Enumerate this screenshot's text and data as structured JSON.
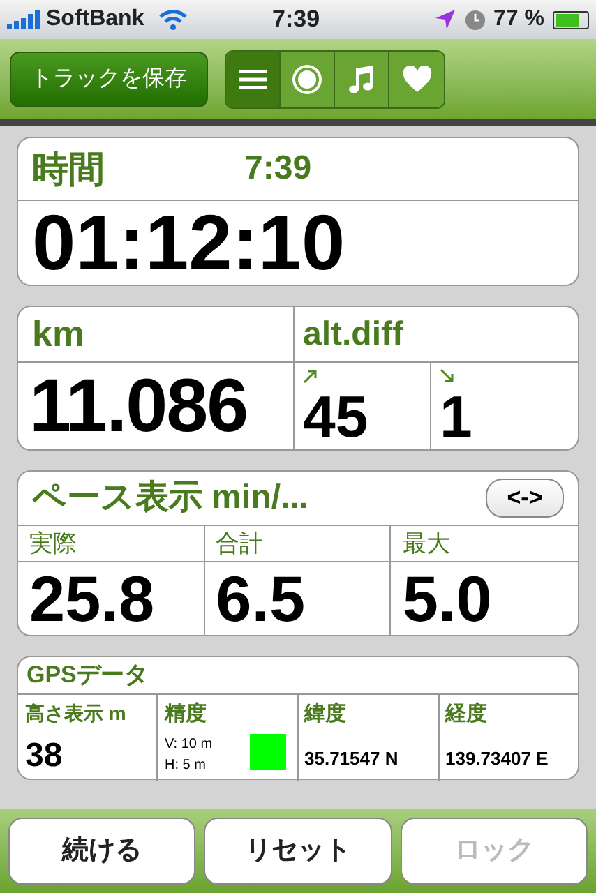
{
  "status_bar": {
    "carrier": "SoftBank",
    "time": "7:39",
    "battery": "77 %"
  },
  "toolbar": {
    "save_button": "トラックを保存",
    "segments": [
      {
        "kind": "list",
        "selected": true
      },
      {
        "kind": "record",
        "selected": false
      },
      {
        "kind": "music",
        "selected": false
      },
      {
        "kind": "heart",
        "selected": false
      }
    ]
  },
  "time_card": {
    "label": "時間",
    "clock": "7:39",
    "value": "01:12:10"
  },
  "distance_card": {
    "label": "km",
    "value": "11.086",
    "alt_label": "alt.diff",
    "ascent": "45",
    "descent": "1"
  },
  "pace_card": {
    "title": "ペース表示 min/...",
    "toggle": "<->",
    "columns": [
      {
        "label": "実際",
        "value": "25.8"
      },
      {
        "label": "合計",
        "value": "6.5"
      },
      {
        "label": "最大",
        "value": "5.0"
      }
    ]
  },
  "gps_card": {
    "title": "GPSデータ",
    "altitude_label": "高さ表示 m",
    "altitude": "38",
    "accuracy_label": "精度",
    "vertical": "V: 10 m",
    "horizontal": "H: 5 m",
    "accuracy_good": true,
    "latitude_label": "緯度",
    "latitude": "35.71547 N",
    "longitude_label": "経度",
    "longitude": "139.73407 E"
  },
  "bottom_buttons": [
    {
      "label": "続ける",
      "disabled": false
    },
    {
      "label": "リセット",
      "disabled": false
    },
    {
      "label": "ロック",
      "disabled": true
    }
  ]
}
